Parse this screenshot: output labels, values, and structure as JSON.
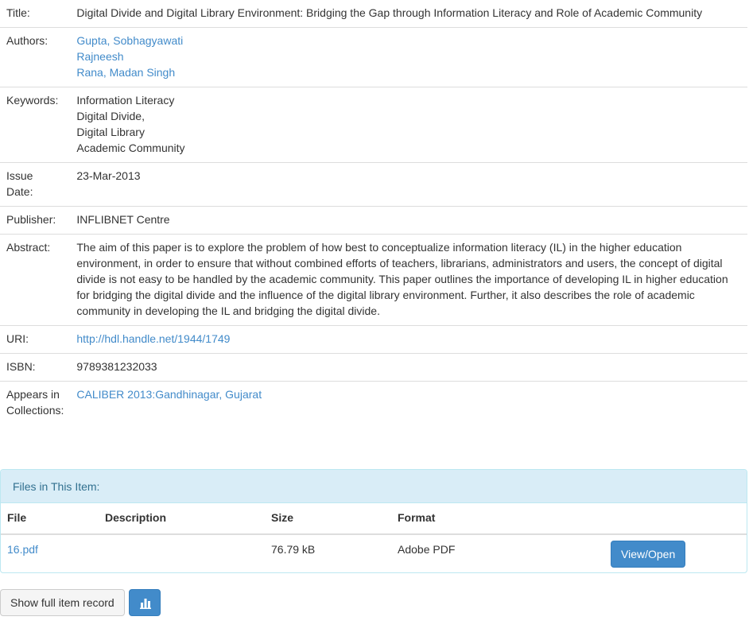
{
  "meta": {
    "title_label": "Title:",
    "title_value": "Digital Divide and Digital Library Environment: Bridging the Gap through Information Literacy and Role of Academic Community",
    "authors_label": "Authors:",
    "authors": [
      "Gupta, Sobhagyawati",
      "Rajneesh",
      "Rana, Madan Singh"
    ],
    "keywords_label": "Keywords:",
    "keywords": [
      "Information Literacy",
      "Digital Divide,",
      "Digital Library",
      "Academic Community"
    ],
    "issue_label_1": "Issue",
    "issue_label_2": "Date:",
    "issue_value": "23-Mar-2013",
    "publisher_label": "Publisher:",
    "publisher_value": "INFLIBNET Centre",
    "abstract_label": "Abstract:",
    "abstract_value": "The aim of this paper is to explore the problem of how best to conceptualize information literacy (IL) in the higher education environment, in order to ensure that without combined efforts of teachers, librarians, administrators and users, the concept of digital divide is not easy to be handled by the academic community. This paper outlines the importance of developing IL in higher education for bridging the digital divide and the influence of the digital library environment. Further, it also describes the role of academic community in developing the IL and bridging the digital divide.",
    "uri_label": "URI:",
    "uri_value": "http://hdl.handle.net/1944/1749",
    "isbn_label": "ISBN:",
    "isbn_value": "9789381232033",
    "collections_label_1": "Appears in",
    "collections_label_2": "Collections:",
    "collections_value": "CALIBER 2013:Gandhinagar, Gujarat"
  },
  "files": {
    "heading": "Files in This Item:",
    "columns": [
      "File",
      "Description",
      "Size",
      "Format"
    ],
    "rows": [
      {
        "file": "16.pdf",
        "description": "",
        "size": "76.79 kB",
        "format": "Adobe PDF",
        "action": "View/Open"
      }
    ]
  },
  "buttons": {
    "show_full": "Show full item record",
    "stats_icon": "bar-chart-icon"
  }
}
